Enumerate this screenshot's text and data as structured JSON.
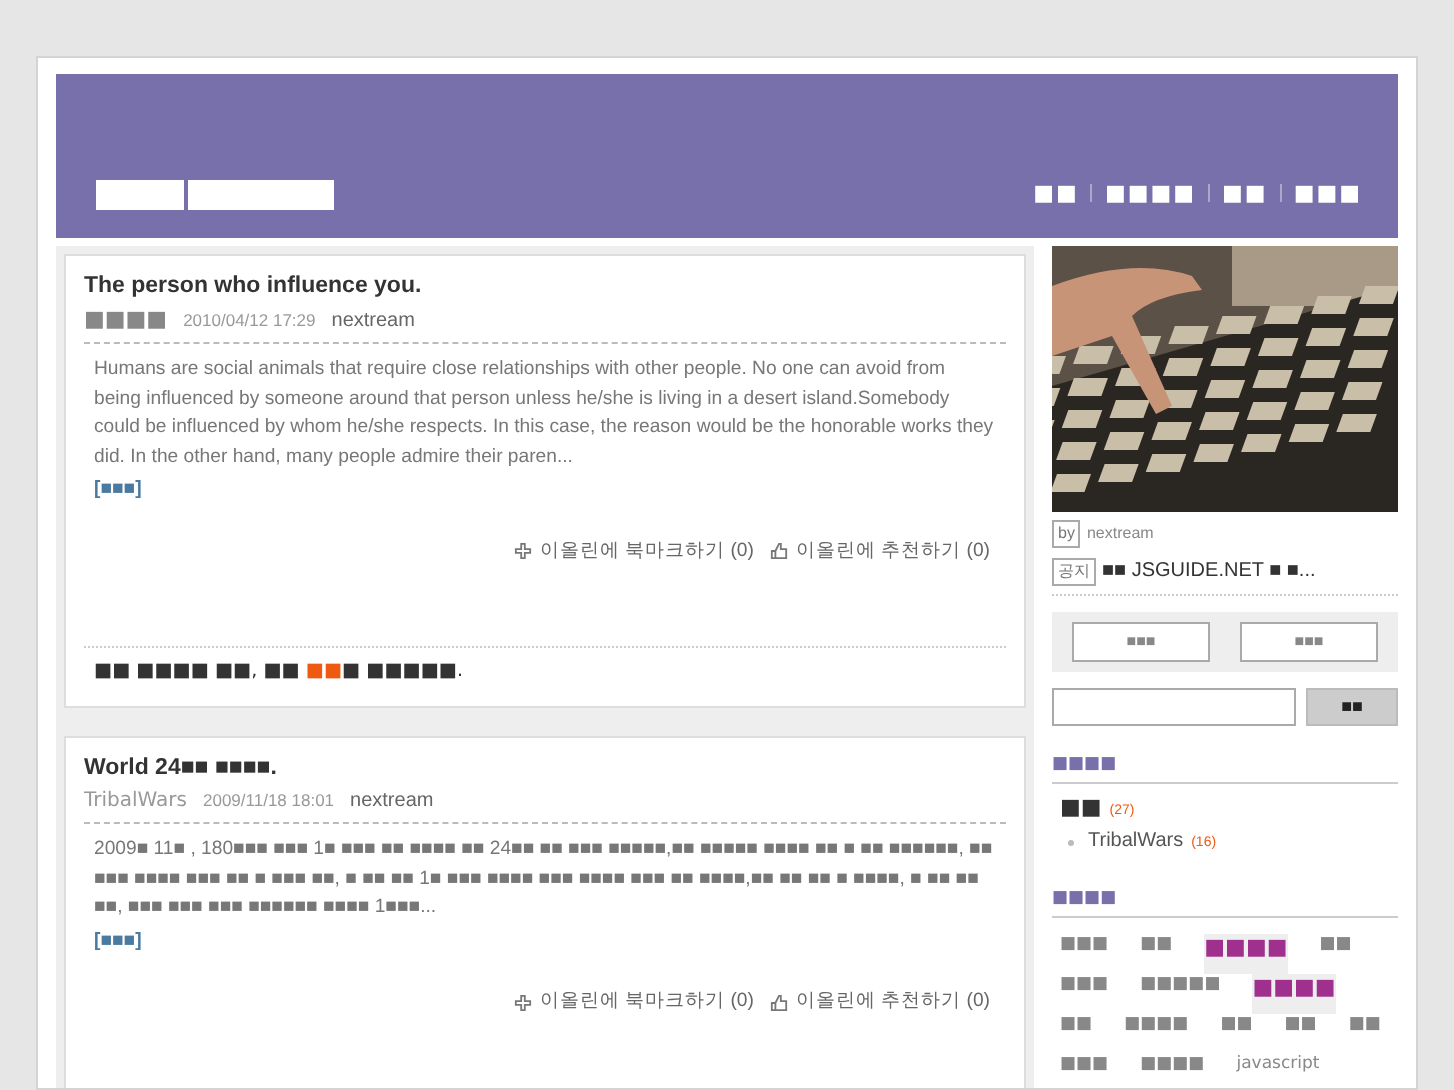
{
  "header": {
    "nav": [
      "■■",
      "■■■■",
      "■■",
      "■■■"
    ]
  },
  "posts": [
    {
      "title": "The person who influence you.",
      "category": "■■■■",
      "date": "2010/04/12 17:29",
      "author": "nextream",
      "excerpt": "Humans are social animals that require close relationships with other people. No one can avoid from being influenced by someone around that person unless he/she is living in a desert island.Somebody could be influenced by whom he/she respects. In this case, the reason would be the honorable works they did. In the other hand, many people admire their paren...",
      "more": "[■■■]",
      "actions": [
        "이올린에 북마크하기 (0)",
        "이올린에 추천하기 (0)"
      ],
      "tagline": [
        {
          "text": "■■ ■■■■ ■■, ■■ ",
          "highlight": false
        },
        {
          "text": "■■",
          "highlight": true
        },
        {
          "text": "■ ■■■■■.",
          "highlight": false
        }
      ]
    },
    {
      "title": "World 24■■ ■■■■.",
      "category": "TribalWars",
      "date": "2009/11/18 18:01",
      "author": "nextream",
      "excerpt": "2009■ 11■ , 180■■■ ■■■ 1■ ■■■ ■■ ■■■■ ■■ 24■■ ■■ ■■■ ■■■■■,■■ ■■■■■ ■■■■ ■■ ■ ■■ ■■■■■■, ■■ ■■■ ■■■■ ■■■ ■■ ■ ■■■ ■■, ■ ■■ ■■ 1■ ■■■ ■■■■ ■■■ ■■■■ ■■■ ■■ ■■■■,■■ ■■ ■■ ■ ■■■■, ■ ■■ ■■ ■■, ■■■ ■■■ ■■■ ■■■■■■ ■■■■ 1■■■...",
      "more": "[■■■]",
      "actions": [
        "이올린에 북마크하기 (0)",
        "이올린에 추천하기 (0)"
      ]
    }
  ],
  "sidebar": {
    "photo_by": {
      "badge": "by",
      "name": "nextream"
    },
    "notice": {
      "badge": "공지",
      "text": "■■ JSGUIDE.NET ■ ■..."
    },
    "buttons": [
      "■■■",
      "■■■"
    ],
    "search": {
      "button": "■■"
    },
    "categories": {
      "heading": "■■■■",
      "items": [
        {
          "label": "■■",
          "count": "(27)",
          "children": [
            {
              "label": "TribalWars",
              "count": "(16)"
            }
          ]
        }
      ]
    },
    "tags": {
      "heading": "■■■■",
      "items": [
        {
          "label": "■■■",
          "hot": false
        },
        {
          "label": "■■",
          "hot": false
        },
        {
          "label": "■■■■",
          "hot": true
        },
        {
          "label": "■■",
          "hot": false
        },
        {
          "label": "■■■",
          "hot": false
        },
        {
          "label": "■■■■■",
          "hot": false
        },
        {
          "label": "■■■■",
          "hot": true
        },
        {
          "label": "■■",
          "hot": false
        },
        {
          "label": "■■■■",
          "hot": false
        },
        {
          "label": "■■",
          "hot": false
        },
        {
          "label": "■■",
          "hot": false
        },
        {
          "label": "■■",
          "hot": false
        },
        {
          "label": "■■■",
          "hot": false
        },
        {
          "label": "■■■■",
          "hot": false
        },
        {
          "label": "javascript",
          "hot": false
        }
      ]
    }
  }
}
